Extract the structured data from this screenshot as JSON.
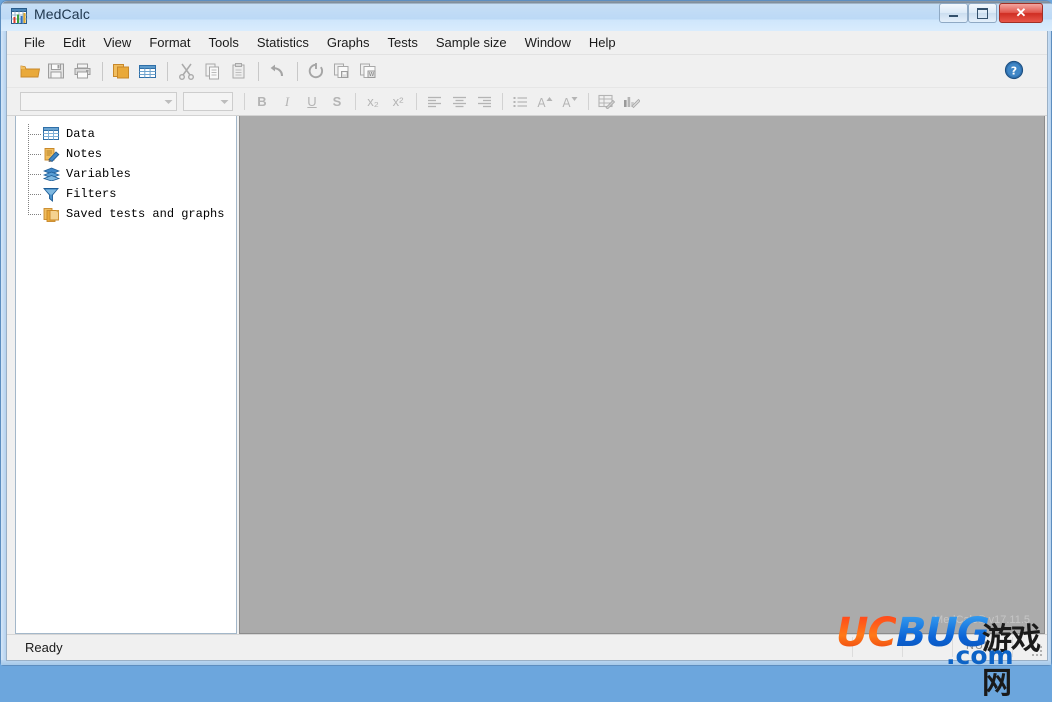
{
  "window": {
    "title": "MedCalc",
    "app_icon": "medcalc-grid-chart-icon",
    "controls": {
      "minimize": "minimize-button",
      "maximize": "maximize-button",
      "close_glyph": "✕"
    }
  },
  "menu": {
    "items": [
      {
        "label": "File"
      },
      {
        "label": "Edit"
      },
      {
        "label": "View"
      },
      {
        "label": "Format"
      },
      {
        "label": "Tools"
      },
      {
        "label": "Statistics"
      },
      {
        "label": "Graphs"
      },
      {
        "label": "Tests"
      },
      {
        "label": "Sample size"
      },
      {
        "label": "Window"
      },
      {
        "label": "Help"
      }
    ]
  },
  "toolbar_main": {
    "buttons": [
      {
        "name": "open-folder-icon"
      },
      {
        "name": "save-icon"
      },
      {
        "name": "print-icon"
      },
      {
        "name": "copy-sheet-icon"
      },
      {
        "name": "spreadsheet-icon"
      },
      {
        "name": "cut-icon"
      },
      {
        "name": "copy-icon"
      },
      {
        "name": "paste-icon"
      },
      {
        "name": "undo-icon"
      },
      {
        "name": "refresh-icon"
      },
      {
        "name": "save-report-icon"
      },
      {
        "name": "export-word-icon"
      }
    ],
    "help_icon": "help-question-icon"
  },
  "toolbar_format": {
    "font_name_value": "",
    "font_name_placeholder": "",
    "font_size_value": "",
    "font_size_placeholder": "",
    "bold_label": "B",
    "italic_label": "I",
    "underline_label": "U",
    "strikethrough_label": "S",
    "subscript_label": "x₂",
    "superscript_label": "x²",
    "buttons": [
      {
        "name": "align-left-icon"
      },
      {
        "name": "align-center-icon"
      },
      {
        "name": "align-right-icon"
      },
      {
        "name": "bullet-list-icon"
      },
      {
        "name": "increase-font-size-icon"
      },
      {
        "name": "decrease-font-size-icon"
      },
      {
        "name": "edit-table-icon"
      },
      {
        "name": "format-chart-icon"
      }
    ]
  },
  "sidebar": {
    "items": [
      {
        "label": "Data",
        "icon": "spreadsheet-icon"
      },
      {
        "label": "Notes",
        "icon": "notes-pencil-icon"
      },
      {
        "label": "Variables",
        "icon": "variables-layers-icon"
      },
      {
        "label": "Filters",
        "icon": "filter-funnel-icon"
      },
      {
        "label": "Saved tests and graphs",
        "icon": "saved-documents-icon"
      }
    ]
  },
  "workspace": {
    "version_label": "MedCalc® v17.11.5",
    "background_color": "#ababab"
  },
  "status_bar": {
    "text": "Ready",
    "num_indicator": "NUM",
    "resize_grip": "resize-grip-icon"
  },
  "watermark": {
    "uc_text": "UC",
    "bug_text": "BUG",
    "cn_text": "游戏网",
    "com_text": ".com",
    "uc_color": "#ff4a16",
    "bug_color": "#0b63d6",
    "com_color": "#0d63c6"
  }
}
